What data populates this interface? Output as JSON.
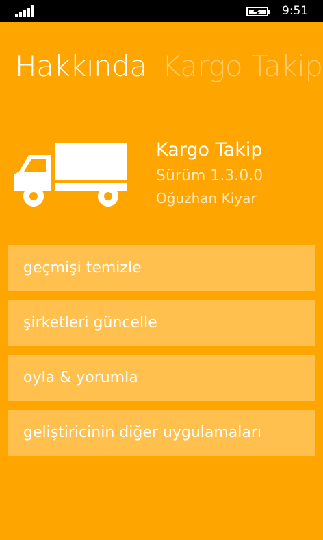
{
  "status": {
    "time": "9:51",
    "signal_icon": "signal-bars-icon",
    "battery_icon": "battery-charging-icon"
  },
  "pivot": {
    "active": "Hakkında",
    "next": "Kargo Takip"
  },
  "app": {
    "icon": "truck-icon",
    "name": "Kargo Takip",
    "version": "Sürüm 1.3.0.0",
    "author": "Oğuzhan Kiyar"
  },
  "menu": [
    {
      "label": "geçmişi temizle"
    },
    {
      "label": "şirketleri güncelle"
    },
    {
      "label": "oyla & yorumla"
    },
    {
      "label": "geliştiricinin diğer uygulamaları"
    }
  ],
  "colors": {
    "accent": "#FFA500",
    "tile": "#FFC04D",
    "statusbar": "#000000"
  }
}
